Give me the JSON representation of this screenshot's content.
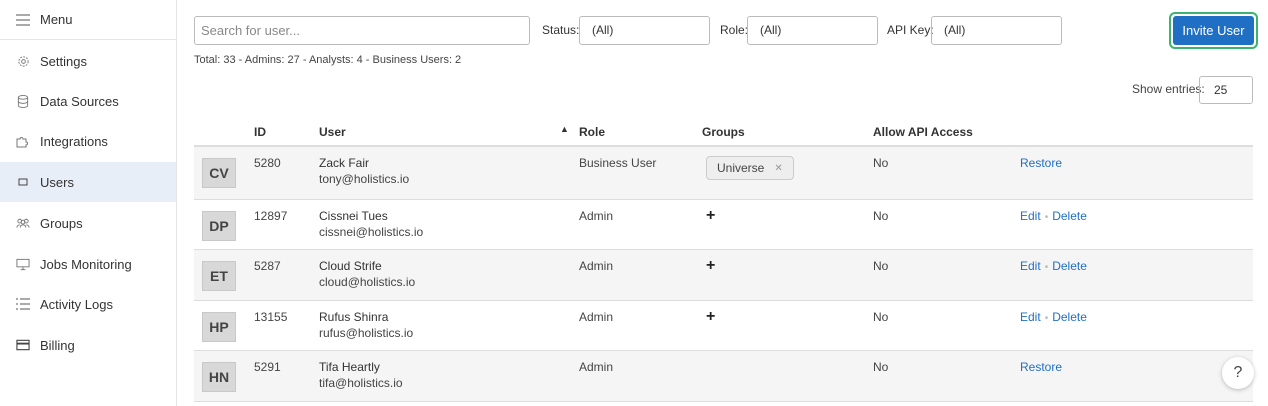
{
  "sidebar": {
    "items": [
      {
        "label": "Menu",
        "icon": "hamburger-icon"
      },
      {
        "label": "Settings",
        "icon": "gear-icon"
      },
      {
        "label": "Data Sources",
        "icon": "database-icon"
      },
      {
        "label": "Integrations",
        "icon": "puzzle-icon"
      },
      {
        "label": "Users",
        "icon": "square-icon"
      },
      {
        "label": "Groups",
        "icon": "groups-icon"
      },
      {
        "label": "Jobs Monitoring",
        "icon": "monitor-icon"
      },
      {
        "label": "Activity Logs",
        "icon": "list-icon"
      },
      {
        "label": "Billing",
        "icon": "credit-card-icon"
      }
    ]
  },
  "toolbar": {
    "search_placeholder": "Search for user...",
    "status_label": "Status:",
    "status_value": "(All)",
    "role_label": "Role:",
    "role_value": "(All)",
    "apikey_label": "API Key:",
    "apikey_value": "(All)",
    "invite_label": "Invite User"
  },
  "totals": "Total: 33 - Admins: 27 - Analysts: 4 - Business Users: 2",
  "show_entries": {
    "label": "Show entries:",
    "value": "25"
  },
  "table": {
    "headers": {
      "id": "ID",
      "user": "User",
      "role": "Role",
      "groups": "Groups",
      "api": "Allow API Access"
    },
    "rows": [
      {
        "initials": "CV",
        "id": "5280",
        "name": "Zack Fair",
        "email": "tony@holistics.io",
        "role": "Business User",
        "group": "Universe",
        "api": "No",
        "actions": [
          "Restore"
        ]
      },
      {
        "initials": "DP",
        "id": "12897",
        "name": "Cissnei Tues",
        "email": "cissnei@holistics.io",
        "role": "Admin",
        "group": "+",
        "api": "No",
        "actions": [
          "Edit",
          "Delete"
        ]
      },
      {
        "initials": "ET",
        "id": "5287",
        "name": "Cloud Strife",
        "email": "cloud@holistics.io",
        "role": "Admin",
        "group": "+",
        "api": "No",
        "actions": [
          "Edit",
          "Delete"
        ]
      },
      {
        "initials": "HP",
        "id": "13155",
        "name": "Rufus Shinra",
        "email": "rufus@holistics.io",
        "role": "Admin",
        "group": "+",
        "api": "No",
        "actions": [
          "Edit",
          "Delete"
        ]
      },
      {
        "initials": "HN",
        "id": "5291",
        "name": "Tifa Heartly",
        "email": "tifa@holistics.io",
        "role": "Admin",
        "group": "",
        "api": "No",
        "actions": [
          "Restore"
        ]
      }
    ]
  },
  "help_label": "?",
  "colors": {
    "accent": "#1f6fc5",
    "active_bg": "#e8eef8",
    "focus_ring": "#3cb371"
  }
}
